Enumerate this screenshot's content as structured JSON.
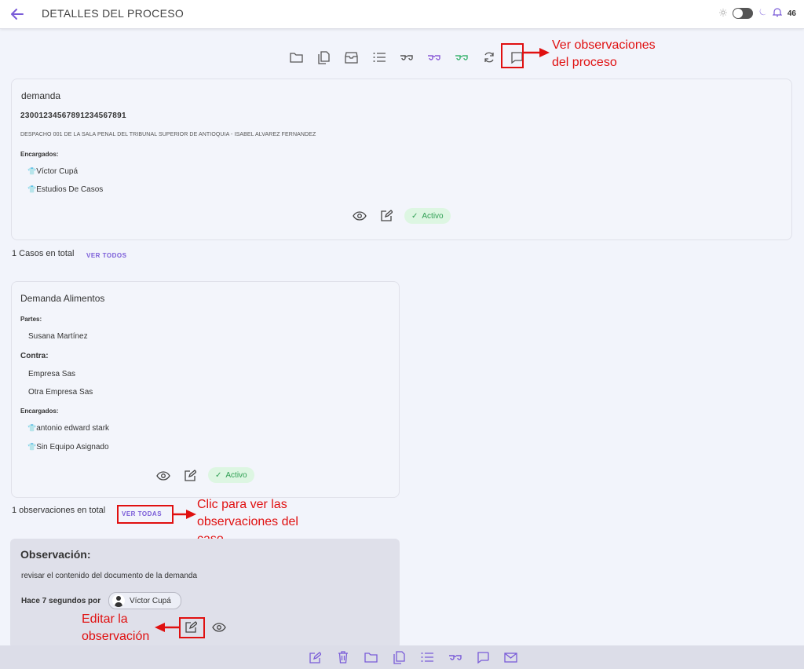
{
  "header": {
    "title": "DETALLES DEL PROCESO",
    "notification_count": "46"
  },
  "process_card": {
    "name": "demanda",
    "number": "23001234567891234567891",
    "office": "DESPACHO 001 DE LA SALA PENAL DEL TRIBUNAL SUPERIOR DE ANTIOQUIA - ISABEL ALVAREZ FERNANDEZ",
    "assigned_label": "Encargados:",
    "assigned": [
      "Víctor Cupá",
      "Estudios De Casos"
    ],
    "status": "Activo"
  },
  "cases": {
    "total_text": "1 Casos en total",
    "link": "VER TODOS"
  },
  "case_card": {
    "name": "Demanda Alimentos",
    "parties_label": "Partes:",
    "parties": [
      "Susana Martínez"
    ],
    "against_label": "Contra:",
    "against": [
      "Empresa Sas",
      "Otra Empresa Sas"
    ],
    "assigned_label": "Encargados:",
    "assigned": [
      "antonio edward stark",
      "Sin Equipo Asignado"
    ],
    "status": "Activo"
  },
  "observations": {
    "total_text": "1 observaciones en total",
    "link": "VER TODAS"
  },
  "observation": {
    "heading": "Observación:",
    "text": "revisar el contenido del documento de la demanda",
    "time": "Hace 7 segundos por",
    "author": "Víctor Cupá"
  },
  "annotations": {
    "top_line1": "Ver observaciones",
    "top_line2": "del proceso",
    "mid_line1": "Clic para ver las",
    "mid_line2": "observaciones del",
    "mid_line3": "caso",
    "edit_line1": "Editar la",
    "edit_line2": "observación"
  },
  "colors": {
    "accent": "#7a5cd8",
    "annotation": "#e01010",
    "active_bg": "#ddf6e2",
    "active_text": "#2e9e52"
  },
  "toolbar_icons": [
    "folder-icon",
    "documents-icon",
    "archive-icon",
    "list-icon",
    "glasses-icon",
    "glasses-purple-icon",
    "glasses-green-icon",
    "refresh-icon",
    "comment-icon"
  ],
  "bottom_icons": [
    "edit-icon",
    "trash-icon",
    "folder-icon",
    "documents-icon",
    "list-icon",
    "glasses-icon",
    "comment-icon",
    "mail-icon"
  ]
}
